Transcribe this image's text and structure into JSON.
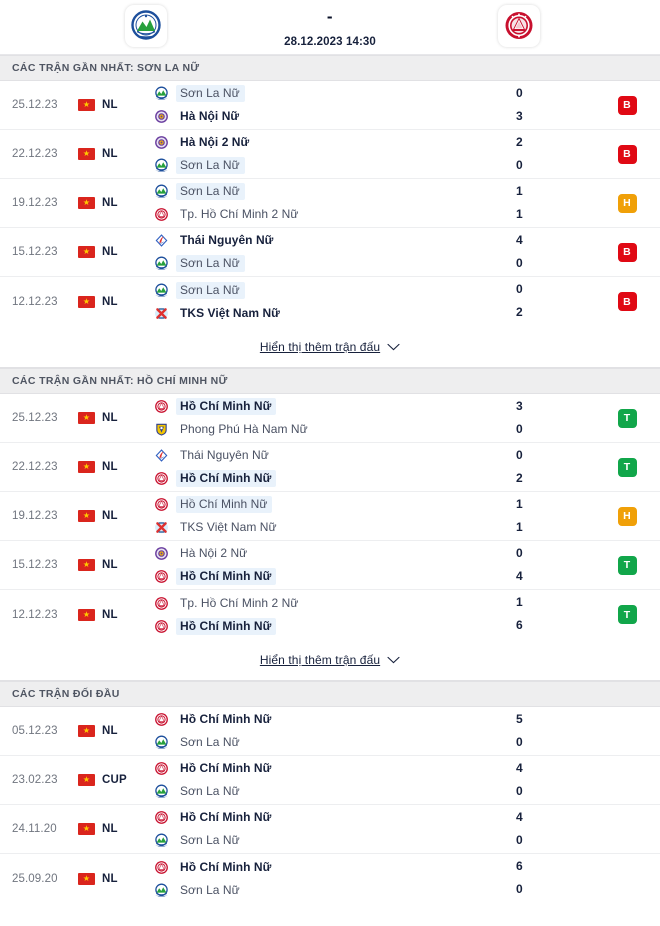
{
  "header": {
    "home_team": "Sơn La Nữ",
    "away_team": "Hồ Chí Minh Nữ",
    "score_separator": "-",
    "datetime": "28.12.2023 14:30",
    "home_crest_icon": "son-la-crest-icon",
    "away_crest_icon": "ho-chi-minh-crest-icon"
  },
  "colors": {
    "win": "#11a64a",
    "loss": "#e00914",
    "draw": "#f0a008",
    "highlight": "#e9f2fb",
    "section_bg": "#eeeeef"
  },
  "sections": [
    {
      "title": "CÁC TRẬN GẦN NHẤT: SƠN LA NỮ",
      "has_show_more": true,
      "show_more_label": "Hiển thị thêm trận đấu",
      "rows": [
        {
          "date": "25.12.23",
          "competition": "NL",
          "flag": "vietnam-flag-icon",
          "home": {
            "name": "Sơn La Nữ",
            "logo": "son-la",
            "bold": false,
            "highlight": true
          },
          "away": {
            "name": "Hà Nội Nữ",
            "logo": "ha-noi",
            "bold": true,
            "highlight": false
          },
          "home_score": "0",
          "away_score": "3",
          "result": "L",
          "result_label": "B"
        },
        {
          "date": "22.12.23",
          "competition": "NL",
          "flag": "vietnam-flag-icon",
          "home": {
            "name": "Hà Nội 2 Nữ",
            "logo": "ha-noi",
            "bold": true,
            "highlight": false
          },
          "away": {
            "name": "Sơn La Nữ",
            "logo": "son-la",
            "bold": false,
            "highlight": true
          },
          "home_score": "2",
          "away_score": "0",
          "result": "L",
          "result_label": "B"
        },
        {
          "date": "19.12.23",
          "competition": "NL",
          "flag": "vietnam-flag-icon",
          "home": {
            "name": "Sơn La Nữ",
            "logo": "son-la",
            "bold": false,
            "highlight": true
          },
          "away": {
            "name": "Tp. Hồ Chí Minh 2 Nữ",
            "logo": "hcm",
            "bold": false,
            "highlight": false
          },
          "home_score": "1",
          "away_score": "1",
          "result": "D",
          "result_label": "H"
        },
        {
          "date": "15.12.23",
          "competition": "NL",
          "flag": "vietnam-flag-icon",
          "home": {
            "name": "Thái Nguyên Nữ",
            "logo": "thai-nguyen",
            "bold": true,
            "highlight": false
          },
          "away": {
            "name": "Sơn La Nữ",
            "logo": "son-la",
            "bold": false,
            "highlight": true
          },
          "home_score": "4",
          "away_score": "0",
          "result": "L",
          "result_label": "B"
        },
        {
          "date": "12.12.23",
          "competition": "NL",
          "flag": "vietnam-flag-icon",
          "home": {
            "name": "Sơn La Nữ",
            "logo": "son-la",
            "bold": false,
            "highlight": true
          },
          "away": {
            "name": "TKS Việt Nam Nữ",
            "logo": "tks",
            "bold": true,
            "highlight": false
          },
          "home_score": "0",
          "away_score": "2",
          "result": "L",
          "result_label": "B"
        }
      ]
    },
    {
      "title": "CÁC TRẬN GẦN NHẤT: HỒ CHÍ MINH NỮ",
      "has_show_more": true,
      "show_more_label": "Hiển thị thêm trận đấu",
      "rows": [
        {
          "date": "25.12.23",
          "competition": "NL",
          "flag": "vietnam-flag-icon",
          "home": {
            "name": "Hồ Chí Minh Nữ",
            "logo": "hcm",
            "bold": true,
            "highlight": true
          },
          "away": {
            "name": "Phong Phú Hà Nam Nữ",
            "logo": "phong-phu",
            "bold": false,
            "highlight": false
          },
          "home_score": "3",
          "away_score": "0",
          "result": "W",
          "result_label": "T"
        },
        {
          "date": "22.12.23",
          "competition": "NL",
          "flag": "vietnam-flag-icon",
          "home": {
            "name": "Thái Nguyên Nữ",
            "logo": "thai-nguyen",
            "bold": false,
            "highlight": false
          },
          "away": {
            "name": "Hồ Chí Minh Nữ",
            "logo": "hcm",
            "bold": true,
            "highlight": true
          },
          "home_score": "0",
          "away_score": "2",
          "result": "W",
          "result_label": "T"
        },
        {
          "date": "19.12.23",
          "competition": "NL",
          "flag": "vietnam-flag-icon",
          "home": {
            "name": "Hồ Chí Minh Nữ",
            "logo": "hcm",
            "bold": false,
            "highlight": true
          },
          "away": {
            "name": "TKS Việt Nam Nữ",
            "logo": "tks",
            "bold": false,
            "highlight": false
          },
          "home_score": "1",
          "away_score": "1",
          "result": "D",
          "result_label": "H"
        },
        {
          "date": "15.12.23",
          "competition": "NL",
          "flag": "vietnam-flag-icon",
          "home": {
            "name": "Hà Nội 2 Nữ",
            "logo": "ha-noi",
            "bold": false,
            "highlight": false
          },
          "away": {
            "name": "Hồ Chí Minh Nữ",
            "logo": "hcm",
            "bold": true,
            "highlight": true
          },
          "home_score": "0",
          "away_score": "4",
          "result": "W",
          "result_label": "T"
        },
        {
          "date": "12.12.23",
          "competition": "NL",
          "flag": "vietnam-flag-icon",
          "home": {
            "name": "Tp. Hồ Chí Minh 2 Nữ",
            "logo": "hcm",
            "bold": false,
            "highlight": false
          },
          "away": {
            "name": "Hồ Chí Minh Nữ",
            "logo": "hcm",
            "bold": true,
            "highlight": true
          },
          "home_score": "1",
          "away_score": "6",
          "result": "W",
          "result_label": "T"
        }
      ]
    },
    {
      "title": "CÁC TRẬN ĐỐI ĐẦU",
      "has_show_more": false,
      "show_more_label": "",
      "rows": [
        {
          "date": "05.12.23",
          "competition": "NL",
          "flag": "vietnam-flag-icon",
          "home": {
            "name": "Hồ Chí Minh Nữ",
            "logo": "hcm",
            "bold": true,
            "highlight": false
          },
          "away": {
            "name": "Sơn La Nữ",
            "logo": "son-la",
            "bold": false,
            "highlight": false
          },
          "home_score": "5",
          "away_score": "0",
          "result": "none",
          "result_label": ""
        },
        {
          "date": "23.02.23",
          "competition": "CUP",
          "flag": "vietnam-flag-icon",
          "home": {
            "name": "Hồ Chí Minh Nữ",
            "logo": "hcm",
            "bold": true,
            "highlight": false
          },
          "away": {
            "name": "Sơn La Nữ",
            "logo": "son-la",
            "bold": false,
            "highlight": false
          },
          "home_score": "4",
          "away_score": "0",
          "result": "none",
          "result_label": ""
        },
        {
          "date": "24.11.20",
          "competition": "NL",
          "flag": "vietnam-flag-icon",
          "home": {
            "name": "Hồ Chí Minh Nữ",
            "logo": "hcm",
            "bold": true,
            "highlight": false
          },
          "away": {
            "name": "Sơn La Nữ",
            "logo": "son-la",
            "bold": false,
            "highlight": false
          },
          "home_score": "4",
          "away_score": "0",
          "result": "none",
          "result_label": ""
        },
        {
          "date": "25.09.20",
          "competition": "NL",
          "flag": "vietnam-flag-icon",
          "home": {
            "name": "Hồ Chí Minh Nữ",
            "logo": "hcm",
            "bold": true,
            "highlight": false
          },
          "away": {
            "name": "Sơn La Nữ",
            "logo": "son-la",
            "bold": false,
            "highlight": false
          },
          "home_score": "6",
          "away_score": "0",
          "result": "none",
          "result_label": ""
        }
      ]
    }
  ]
}
